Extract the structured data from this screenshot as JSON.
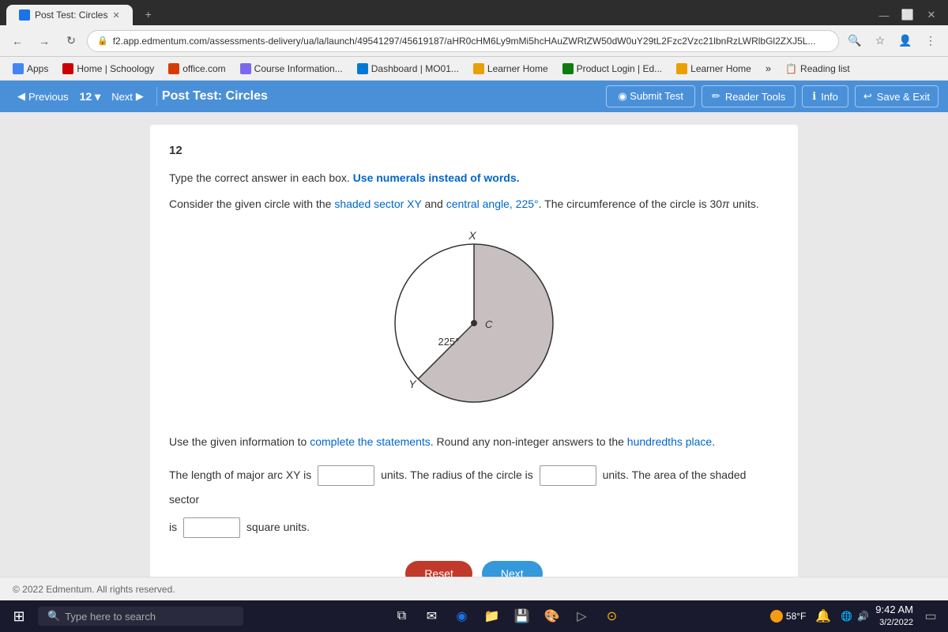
{
  "browser": {
    "tab_title": "Post Test: Circles",
    "url": "f2.app.edmentum.com/assessments-delivery/ua/la/launch/49541297/45619187/aHR0cHM6Ly9mMi5hcHAuZWRtZW50dW0uY29tL2Fzc2Vzc21lbnRzLWRlbGl2ZXJ5L...",
    "bookmarks": [
      {
        "id": "apps",
        "label": "Apps",
        "color": "#4285f4"
      },
      {
        "id": "schoology",
        "label": "Home | Schoology",
        "color": "#cc0000"
      },
      {
        "id": "office",
        "label": "office.com",
        "color": "#d83b01"
      },
      {
        "id": "course",
        "label": "Course Information...",
        "color": "#7b68ee"
      },
      {
        "id": "dashboard",
        "label": "Dashboard | MO01...",
        "color": "#0078d4"
      },
      {
        "id": "learnerhome1",
        "label": "Learner Home",
        "color": "#e8a000"
      },
      {
        "id": "product",
        "label": "Product Login | Ed...",
        "color": "#107c10"
      },
      {
        "id": "learnerhome2",
        "label": "Learner Home",
        "color": "#e8a000"
      }
    ],
    "reading_list_label": "Reading list"
  },
  "toolbar": {
    "previous_label": "Previous",
    "question_number": "12",
    "next_label": "Next",
    "test_title": "Post Test: Circles",
    "submit_label": "Submit Test",
    "reader_tools_label": "Reader Tools",
    "info_label": "Info",
    "save_exit_label": "Save & Exit"
  },
  "question": {
    "number": "12",
    "instruction1": "Type the correct answer in each box. Use numerals instead of words.",
    "instruction2_pre": "Consider the given circle with the shaded sector XY and central angle, 225°. The circumference of the circle is 30",
    "instruction2_pi": "π",
    "instruction2_post": " units.",
    "diagram": {
      "label_x": "X",
      "label_y": "Y",
      "label_c": "C",
      "label_angle": "225°"
    },
    "statement_pre": "Use the given information to complete the statements. Round any non-integer answers to the hundredths place.",
    "fill1_pre": "The length of major arc XY is",
    "fill1_post": "units. The radius of the circle is",
    "fill2_post": "units. The area of the shaded sector",
    "fill3_pre": "is",
    "fill3_post": "square units.",
    "reset_label": "Reset",
    "next_label": "Next"
  },
  "footer": {
    "copyright": "© 2022 Edmentum. All rights reserved."
  },
  "taskbar": {
    "search_placeholder": "Type here to search",
    "weather": "58°F",
    "time": "9:42 AM",
    "date": "3/2/2022"
  }
}
